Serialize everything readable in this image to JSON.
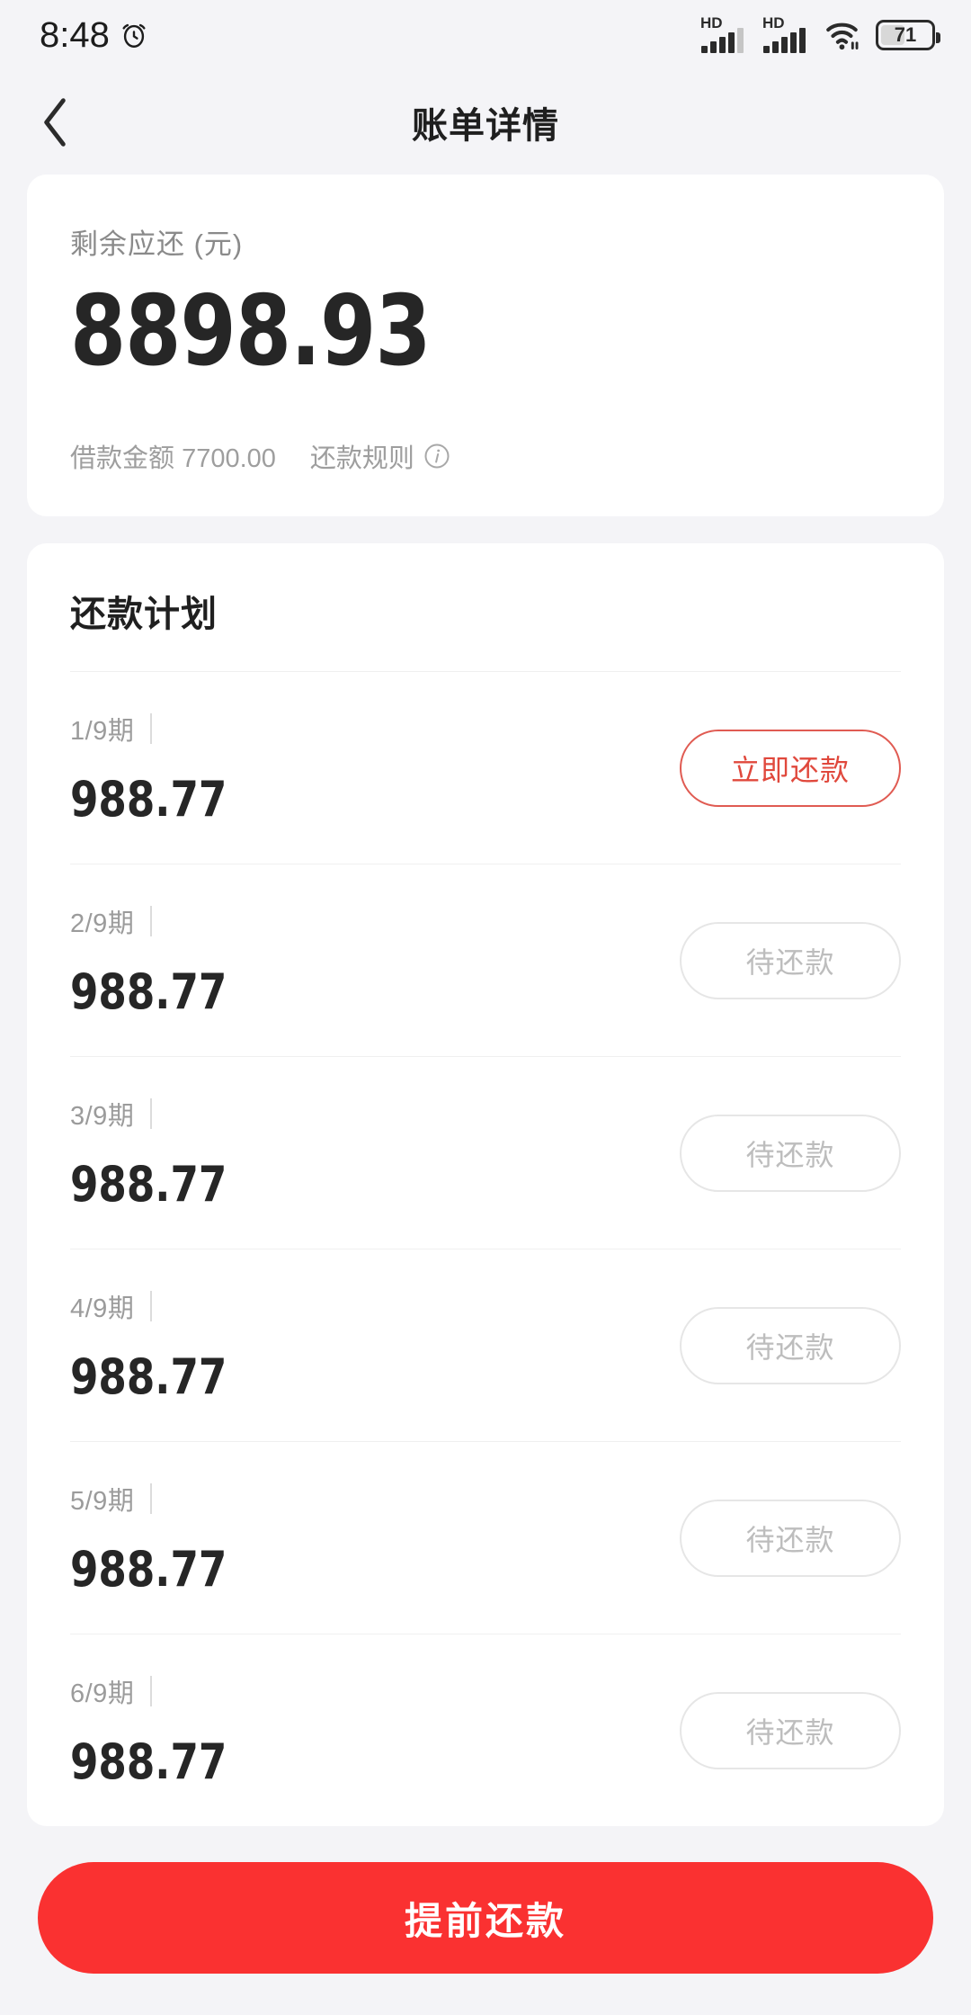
{
  "status_bar": {
    "time": "8:48",
    "alarm_icon": "alarm-clock-icon",
    "signal_1_label": "HD",
    "signal_2_label": "HD",
    "wifi_icon": "wifi-icon",
    "battery_level": "71"
  },
  "nav": {
    "back_icon": "chevron-left-icon",
    "title": "账单详情"
  },
  "summary": {
    "label": "剩余应还 (元)",
    "amount": "8898.93",
    "loan_label": "借款金额",
    "loan_amount": "7700.00",
    "rule_label": "还款规则",
    "info_icon": "info-circle-icon"
  },
  "plan": {
    "title": "还款计划",
    "installments": [
      {
        "term": "1/9期",
        "amount": "988.77",
        "status": "立即还款",
        "state": "pay"
      },
      {
        "term": "2/9期",
        "amount": "988.77",
        "status": "待还款",
        "state": "pending"
      },
      {
        "term": "3/9期",
        "amount": "988.77",
        "status": "待还款",
        "state": "pending"
      },
      {
        "term": "4/9期",
        "amount": "988.77",
        "status": "待还款",
        "state": "pending"
      },
      {
        "term": "5/9期",
        "amount": "988.77",
        "status": "待还款",
        "state": "pending"
      },
      {
        "term": "6/9期",
        "amount": "988.77",
        "status": "待还款",
        "state": "pending"
      }
    ]
  },
  "cta": {
    "label": "提前还款"
  },
  "colors": {
    "brand_red": "#fa3131",
    "pay_button_red": "#e0483c",
    "page_background": "#f4f4f7",
    "card_background": "#ffffff"
  }
}
